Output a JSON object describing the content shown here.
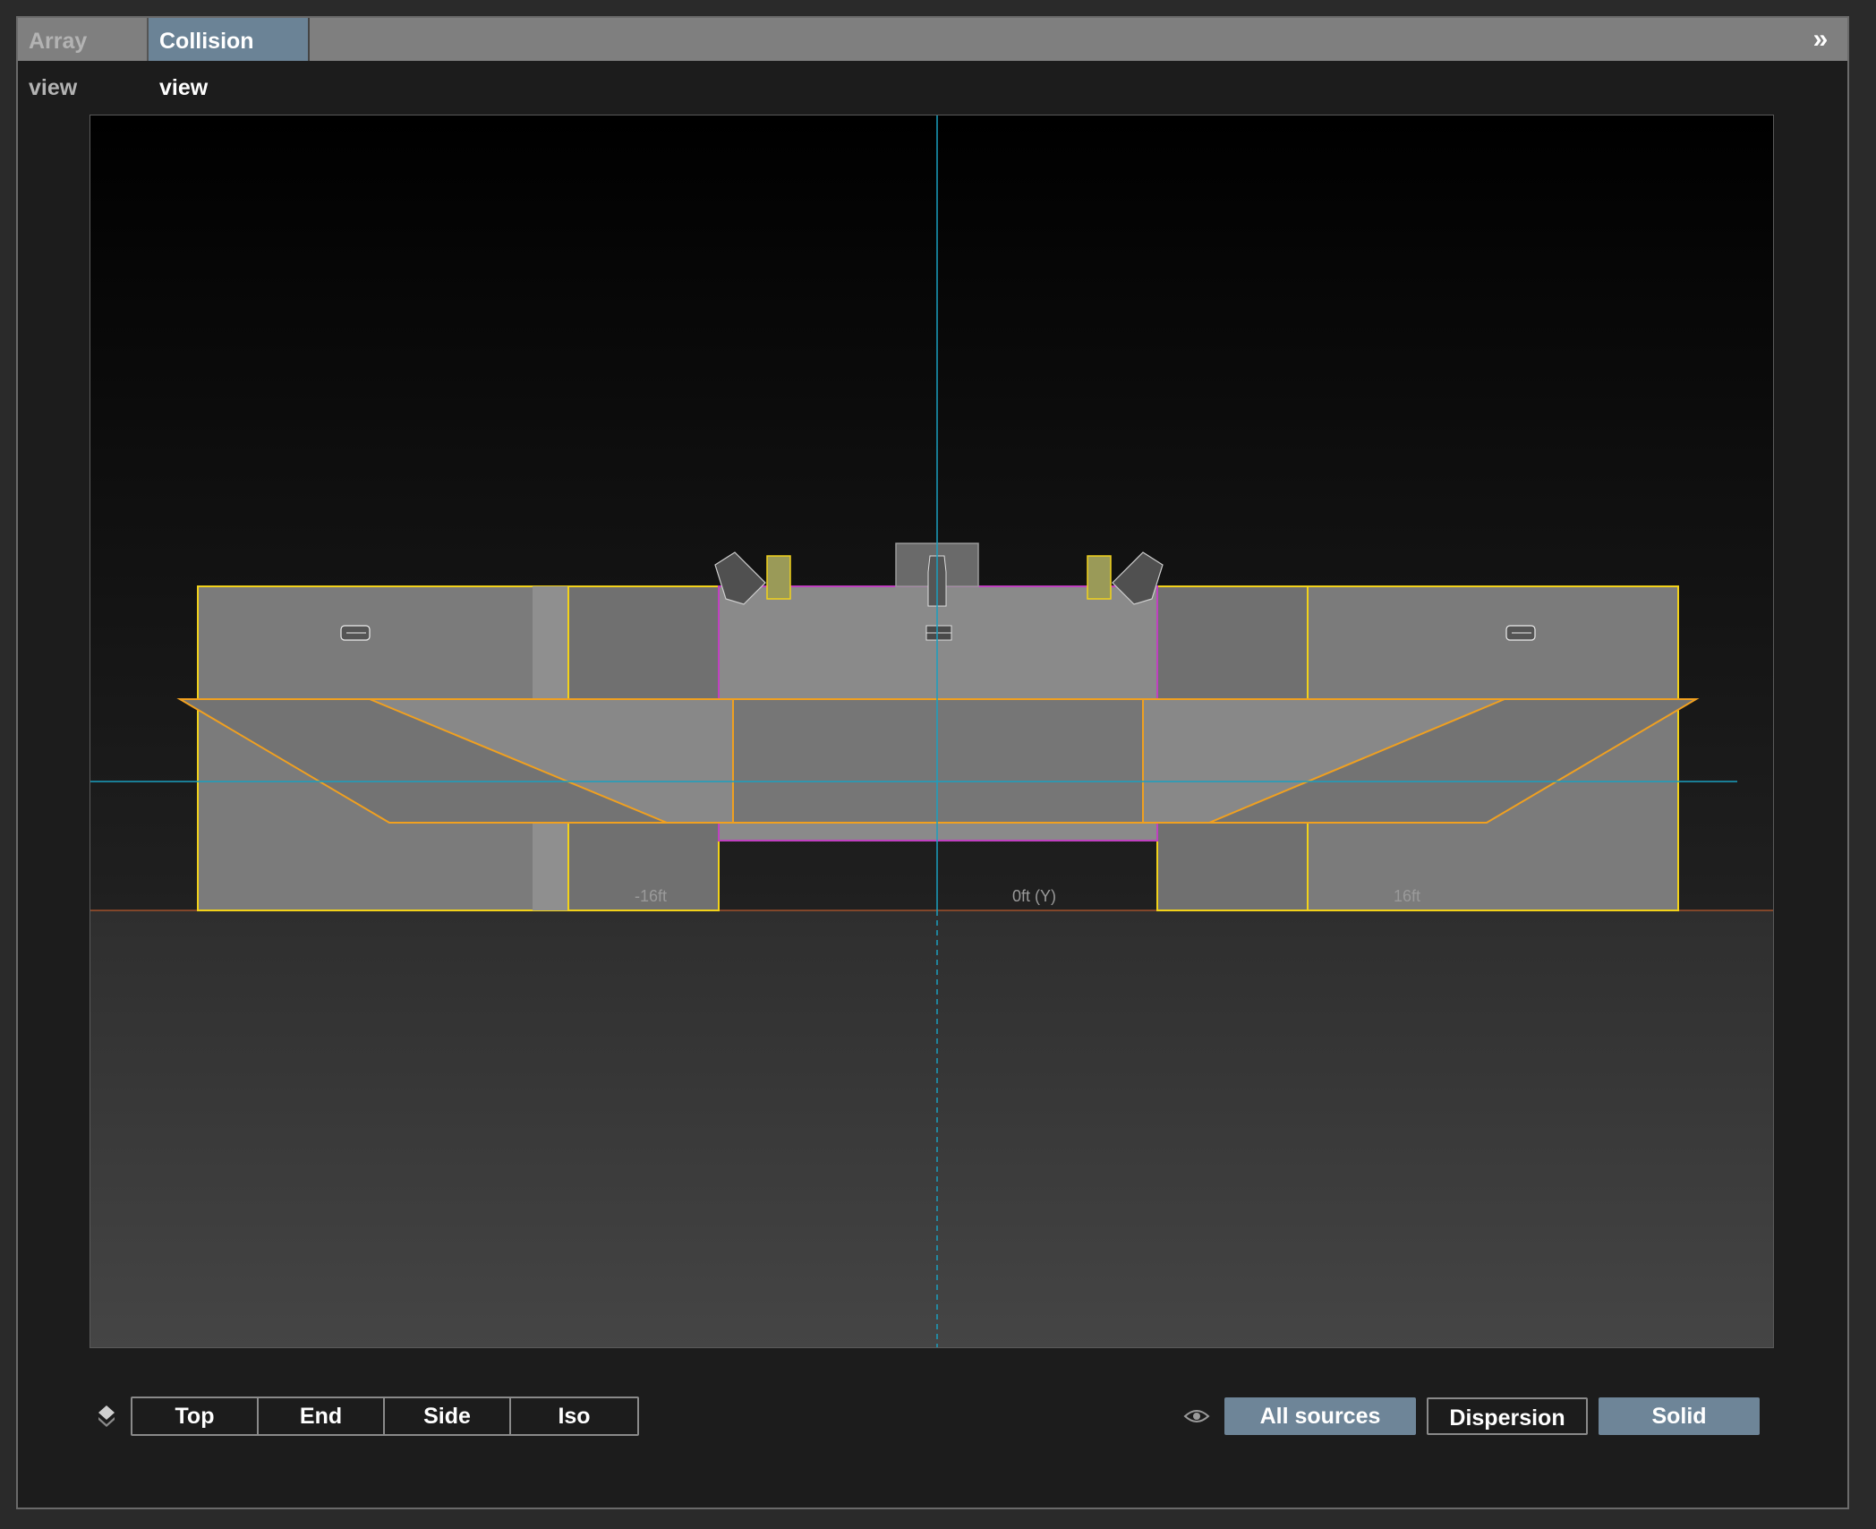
{
  "tabs": [
    {
      "label": "Array view",
      "active": false
    },
    {
      "label": "Collision view",
      "active": true
    }
  ],
  "expand_icon": "double-chevron-right-icon",
  "viewport": {
    "axis_labels": {
      "left": "-16ft",
      "center": "0ft (Y)",
      "right": "16ft"
    },
    "colors": {
      "outline_yellow": "#f2d21a",
      "outline_orange": "#f0a020",
      "outline_magenta": "#c040c0",
      "axis_cyan": "#1a9fbf",
      "solid_gray": "#808080"
    }
  },
  "view_buttons": [
    "Top",
    "End",
    "Side",
    "Iso"
  ],
  "layers_icon": "layers-icon",
  "eye_icon": "eye-icon",
  "display_buttons": {
    "all_sources": {
      "label": "All sources",
      "active": true
    },
    "dispersion": {
      "label": "Dispersion",
      "active": false
    },
    "solid": {
      "label": "Solid",
      "active": true
    }
  }
}
